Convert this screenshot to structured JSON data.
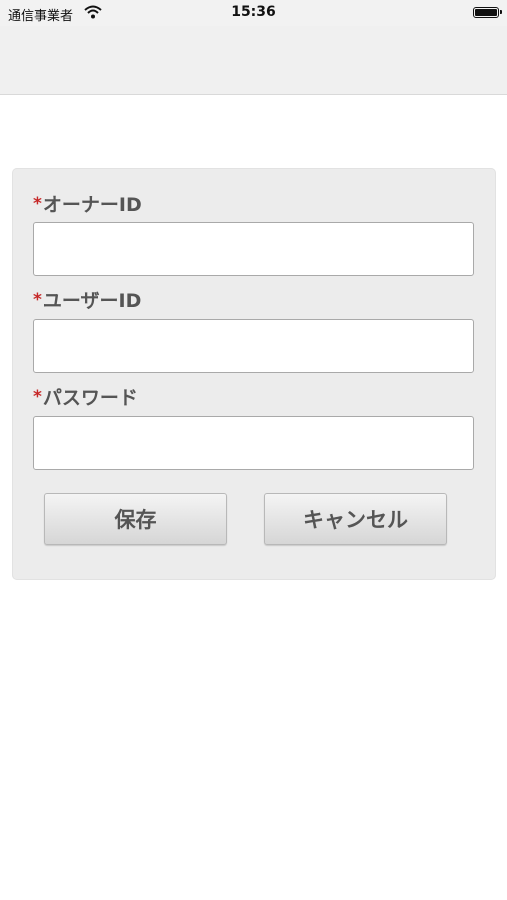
{
  "status_bar": {
    "carrier": "通信事業者",
    "time": "15:36",
    "wifi_icon": "wifi-icon",
    "battery_icon": "battery-icon"
  },
  "form": {
    "required_mark": "*",
    "fields": [
      {
        "label": "オーナーID",
        "value": ""
      },
      {
        "label": "ユーザーID",
        "value": ""
      },
      {
        "label": "パスワード",
        "value": ""
      }
    ],
    "save_label": "保存",
    "cancel_label": "キャンセル"
  },
  "colors": {
    "required": "#c62828",
    "panel_bg": "#ececec",
    "navbar_bg": "#f0f0f0"
  }
}
